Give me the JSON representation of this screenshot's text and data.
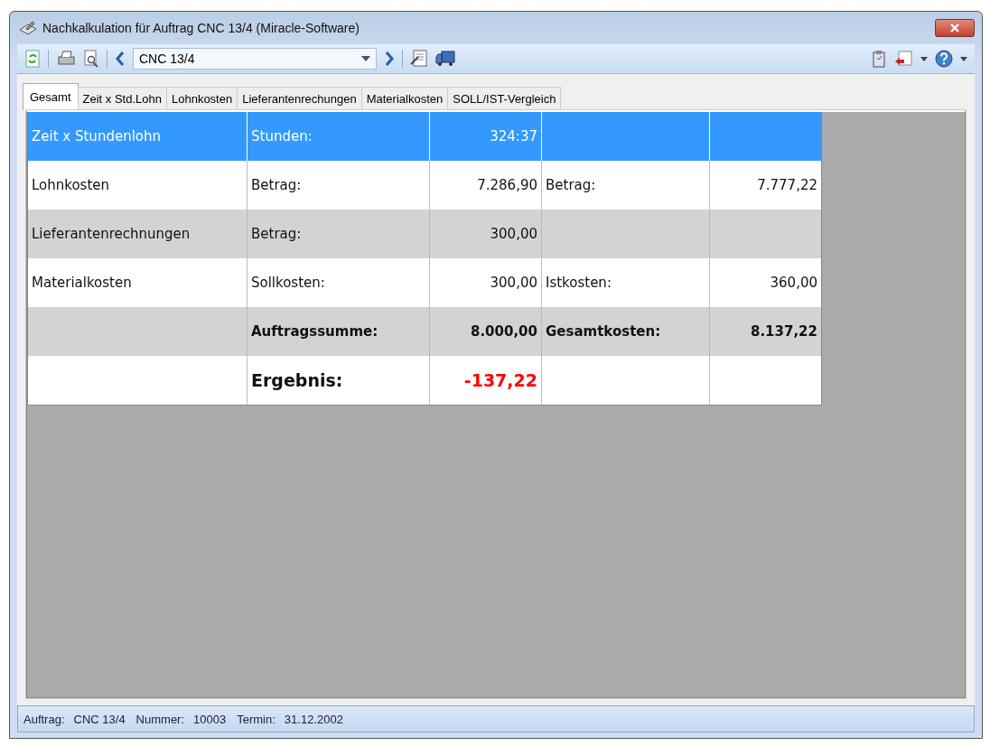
{
  "window": {
    "title": "Nachkalkulation für Auftrag CNC 13/4 (Miracle-Software)"
  },
  "toolbar": {
    "record_selector": {
      "value": "CNC 13/4"
    }
  },
  "tabs": [
    {
      "label": "Gesamt",
      "selected": true
    },
    {
      "label": "Zeit x Std.Lohn",
      "selected": false
    },
    {
      "label": "Lohnkosten",
      "selected": false
    },
    {
      "label": "Lieferantenrechungen",
      "selected": false
    },
    {
      "label": "Materialkosten",
      "selected": false
    },
    {
      "label": "SOLL/IST-Vergleich",
      "selected": false
    }
  ],
  "table": {
    "rows": [
      {
        "kind": "plain",
        "selected": true,
        "cells": [
          "Zeit x Stundenlohn",
          "Stunden:",
          "324:37",
          "",
          ""
        ]
      },
      {
        "kind": "plain",
        "selected": false,
        "cells": [
          "Lohnkosten",
          "Betrag:",
          "7.286,90",
          "Betrag:",
          "7.777,22"
        ]
      },
      {
        "kind": "plain",
        "selected": false,
        "cells": [
          "Lieferantenrechnungen",
          "Betrag:",
          "300,00",
          "",
          ""
        ]
      },
      {
        "kind": "plain",
        "selected": false,
        "cells": [
          "Materialkosten",
          "Sollkosten:",
          "300,00",
          "Istkosten:",
          "360,00"
        ]
      },
      {
        "kind": "total",
        "selected": false,
        "cells": [
          "",
          "Auftragssumme:",
          "8.000,00",
          "Gesamtkosten:",
          "8.137,22"
        ]
      },
      {
        "kind": "result",
        "selected": false,
        "cells": [
          "",
          "Ergebnis:",
          "-137,22",
          "",
          ""
        ]
      }
    ]
  },
  "status_bar": [
    {
      "label": "Auftrag:",
      "value": "CNC 13/4"
    },
    {
      "label": "Nummer:",
      "value": "10003"
    },
    {
      "label": "Termin:",
      "value": "31.12.2002"
    }
  ]
}
